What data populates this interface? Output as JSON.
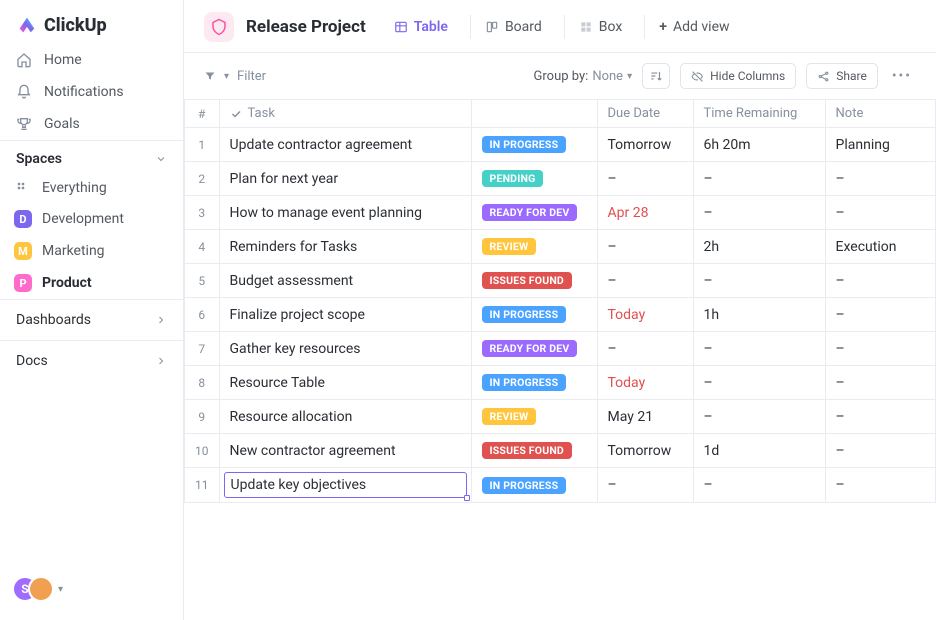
{
  "brand": "ClickUp",
  "nav": {
    "home": "Home",
    "notifications": "Notifications",
    "goals": "Goals"
  },
  "spaces_header": "Spaces",
  "spaces": {
    "everything": "Everything",
    "items": [
      {
        "label": "Development",
        "initial": "D",
        "color": "#7b68ee"
      },
      {
        "label": "Marketing",
        "initial": "M",
        "color": "#ffc53d"
      },
      {
        "label": "Product",
        "initial": "P",
        "color": "#ff6bcb",
        "active": true
      }
    ]
  },
  "sidebar_sections": {
    "dashboards": "Dashboards",
    "docs": "Docs"
  },
  "project": {
    "title": "Release Project",
    "views": {
      "table": "Table",
      "board": "Board",
      "box": "Box",
      "add": "Add view"
    }
  },
  "toolbar": {
    "filter": "Filter",
    "group_by_label": "Group by:",
    "group_by_value": "None",
    "hide_columns": "Hide Columns",
    "share": "Share"
  },
  "columns": {
    "num": "#",
    "task": "Task",
    "due": "Due Date",
    "time": "Time Remaining",
    "note": "Note"
  },
  "status_colors": {
    "IN PROGRESS": "#4aa3ff",
    "PENDING": "#45d1c8",
    "READY FOR DEV": "#9b6bff",
    "REVIEW": "#ffc53d",
    "ISSUES FOUND": "#e0524f"
  },
  "rows": [
    {
      "n": "1",
      "task": "Update contractor agreement",
      "status": "IN PROGRESS",
      "due": "Tomorrow",
      "time": "6h 20m",
      "note": "Planning"
    },
    {
      "n": "2",
      "task": "Plan for next year",
      "status": "PENDING",
      "due": "–",
      "time": "–",
      "note": "–"
    },
    {
      "n": "3",
      "task": "How to manage event planning",
      "status": "READY FOR DEV",
      "due": "Apr 28",
      "due_red": true,
      "time": "–",
      "note": "–"
    },
    {
      "n": "4",
      "task": "Reminders for Tasks",
      "status": "REVIEW",
      "due": "–",
      "time": "2h",
      "note": "Execution"
    },
    {
      "n": "5",
      "task": "Budget assessment",
      "status": "ISSUES FOUND",
      "due": "–",
      "time": "–",
      "note": "–"
    },
    {
      "n": "6",
      "task": "Finalize project scope",
      "status": "IN PROGRESS",
      "due": "Today",
      "due_red": true,
      "time": "1h",
      "note": "–"
    },
    {
      "n": "7",
      "task": "Gather key resources",
      "status": "READY FOR DEV",
      "due": "–",
      "time": "–",
      "note": "–"
    },
    {
      "n": "8",
      "task": "Resource Table",
      "status": "IN PROGRESS",
      "due": "Today",
      "due_red": true,
      "time": "–",
      "note": "–"
    },
    {
      "n": "9",
      "task": "Resource allocation",
      "status": "REVIEW",
      "due": "May 21",
      "time": "–",
      "note": "–"
    },
    {
      "n": "10",
      "task": "New contractor agreement",
      "status": "ISSUES FOUND",
      "due": "Tomorrow",
      "time": "1d",
      "note": "–"
    },
    {
      "n": "11",
      "task": "Update key objectives",
      "status": "IN PROGRESS",
      "due": "–",
      "time": "–",
      "note": "–",
      "editing": true
    }
  ],
  "avatars": [
    {
      "initial": "S",
      "bg": "#a06bff"
    },
    {
      "initial": "",
      "bg": "#f0a050"
    }
  ]
}
